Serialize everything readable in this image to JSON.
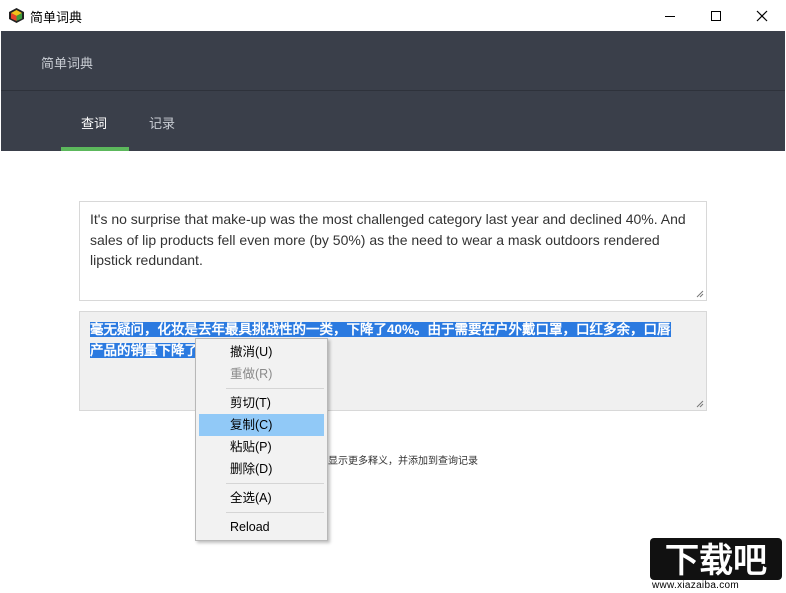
{
  "window": {
    "title": "简单词典"
  },
  "header": {
    "app_name": "简单词典",
    "tabs": [
      {
        "label": "查词",
        "active": true
      },
      {
        "label": "记录",
        "active": false
      }
    ],
    "accent_color": "#5cb85c"
  },
  "main": {
    "input_text": "It's no surprise that make-up was the most challenged category last year and declined 40%. And sales of lip products fell even more (by 50%) as the need to wear a mask outdoors rendered lipstick redundant.",
    "output_line1": "毫无疑问，化妆是去年最具挑战性的一类，下降了40%。由于需要在户外戴口罩，口红多余，口唇",
    "output_line2": "产品的销量下降了",
    "hint": "显示更多释义，并添加到查询记录"
  },
  "context_menu": {
    "items": [
      {
        "label": "撤消(U)",
        "enabled": true
      },
      {
        "label": "重做(R)",
        "enabled": false
      },
      {
        "label": "剪切(T)",
        "enabled": true
      },
      {
        "label": "复制(C)",
        "enabled": true,
        "highlighted": true
      },
      {
        "label": "粘贴(P)",
        "enabled": true
      },
      {
        "label": "删除(D)",
        "enabled": true
      },
      {
        "label": "全选(A)",
        "enabled": true
      },
      {
        "label": "Reload",
        "enabled": true
      }
    ]
  },
  "watermark": {
    "logo_text": "下载吧",
    "url": "www.xiazaiba.com"
  }
}
